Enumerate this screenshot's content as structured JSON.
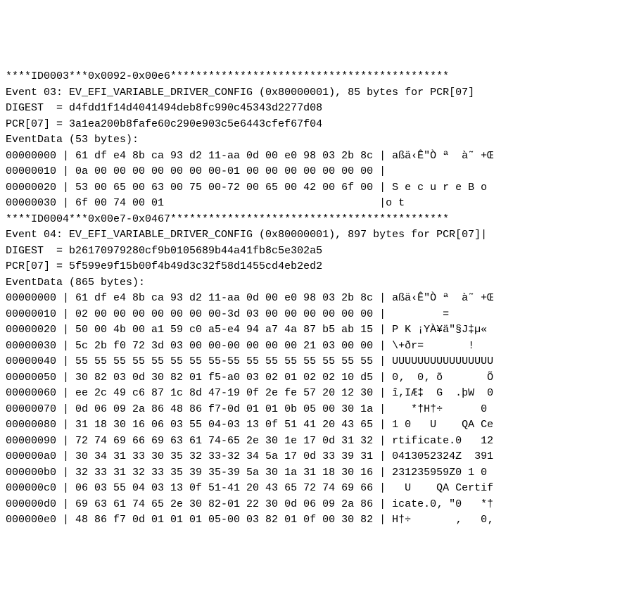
{
  "lines": [
    "****ID0003***0x0092-0x00e6********************************************",
    "Event 03: EV_EFI_VARIABLE_DRIVER_CONFIG (0x80000001), 85 bytes for PCR[07]",
    "DIGEST  = d4fdd1f14d4041494deb8fc990c45343d2277d08",
    "PCR[07] = 3a1ea200b8fafe60c290e903c5e6443cfef67f04",
    "EventData (53 bytes):",
    "00000000 | 61 df e4 8b ca 93 d2 11-aa 0d 00 e0 98 03 2b 8c | aßä‹Ê\"Ò ª  à˜ +Œ",
    "00000010 | 0a 00 00 00 00 00 00 00-01 00 00 00 00 00 00 00 |",
    "00000020 | 53 00 65 00 63 00 75 00-72 00 65 00 42 00 6f 00 | S e c u r e B o",
    "00000030 | 6f 00 74 00 01                                  |o t",
    "****ID0004***0x00e7-0x0467********************************************",
    "Event 04: EV_EFI_VARIABLE_DRIVER_CONFIG (0x80000001), 897 bytes for PCR[07]|",
    "DIGEST  = b26170979280cf9b0105689b44a41fb8c5e302a5",
    "PCR[07] = 5f599e9f15b00f4b49d3c32f58d1455cd4eb2ed2",
    "EventData (865 bytes):",
    "00000000 | 61 df e4 8b ca 93 d2 11-aa 0d 00 e0 98 03 2b 8c | aßä‹Ê\"Ò ª  à˜ +Œ",
    "00000010 | 02 00 00 00 00 00 00 00-3d 03 00 00 00 00 00 00 |         =",
    "00000020 | 50 00 4b 00 a1 59 c0 a5-e4 94 a7 4a 87 b5 ab 15 | P K ¡YÀ¥ä\"§J‡µ«",
    "00000030 | 5c 2b f0 72 3d 03 00 00-00 00 00 00 21 03 00 00 | \\+ðr=       !",
    "00000040 | 55 55 55 55 55 55 55 55-55 55 55 55 55 55 55 55 | UUUUUUUUUUUUUUUU",
    "00000050 | 30 82 03 0d 30 82 01 f5-a0 03 02 01 02 02 10 d5 | 0‚  0‚ õ       Õ",
    "00000060 | ee 2c 49 c6 87 1c 8d 47-19 0f 2e fe 57 20 12 30 | î,IÆ‡  G  .þW  0",
    "00000070 | 0d 06 09 2a 86 48 86 f7-0d 01 01 0b 05 00 30 1a |    *†H†÷      0",
    "00000080 | 31 18 30 16 06 03 55 04-03 13 0f 51 41 20 43 65 | 1 0   U    QA Ce",
    "00000090 | 72 74 69 66 69 63 61 74-65 2e 30 1e 17 0d 31 32 | rtificate.0   12",
    "000000a0 | 30 34 31 33 30 35 32 33-32 34 5a 17 0d 33 39 31 | 0413052324Z  391",
    "000000b0 | 32 33 31 32 33 35 39 35-39 5a 30 1a 31 18 30 16 | 231235959Z0 1 0",
    "000000c0 | 06 03 55 04 03 13 0f 51-41 20 43 65 72 74 69 66 |   U    QA Certif",
    "000000d0 | 69 63 61 74 65 2e 30 82-01 22 30 0d 06 09 2a 86 | icate.0‚ \"0   *†",
    "000000e0 | 48 86 f7 0d 01 01 01 05-00 03 82 01 0f 00 30 82 | H†÷       ‚   0‚"
  ]
}
